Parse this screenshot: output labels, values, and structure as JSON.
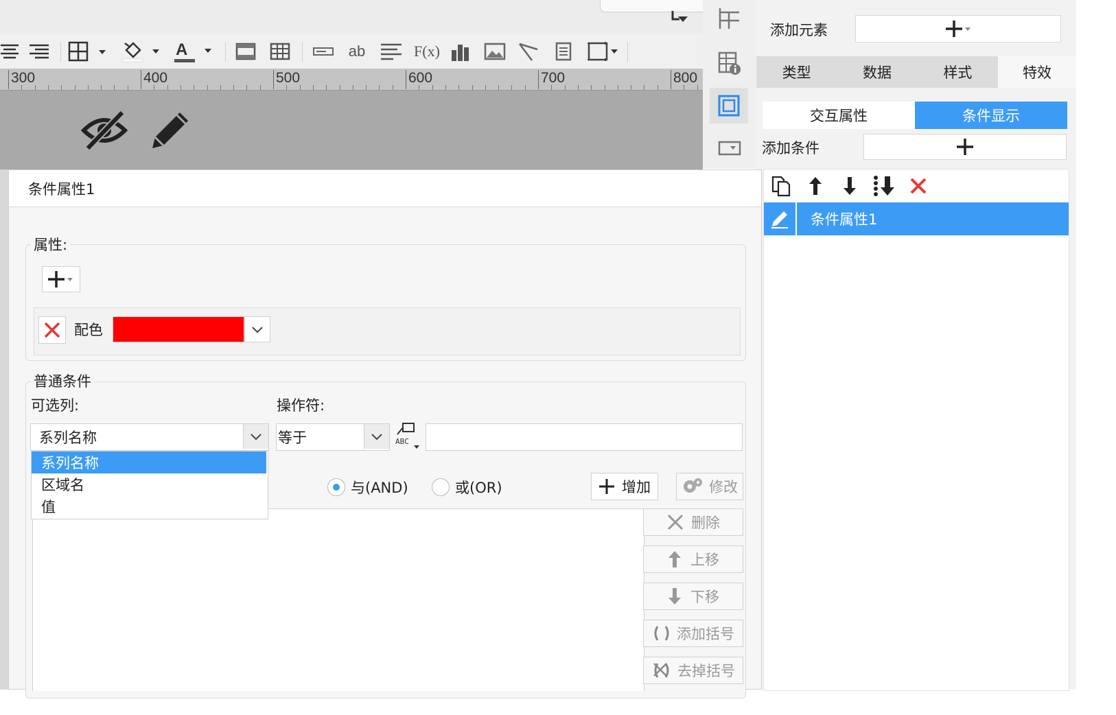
{
  "ruler": {
    "labels": [
      "300",
      "400",
      "500",
      "600",
      "700",
      "800"
    ]
  },
  "right_panel": {
    "add_element_label": "添加元素",
    "tabs": [
      "类型",
      "数据",
      "样式",
      "特效"
    ],
    "subtabs": [
      "交互属性",
      "条件显示"
    ],
    "add_condition_label": "添加条件",
    "condition_item": "条件属性1"
  },
  "dialog": {
    "title": "条件属性1",
    "property_group_title": "属性:",
    "property_row": {
      "label": "配色",
      "color": "#ff0000"
    },
    "normal_group_title": "普通条件",
    "optional_column_label": "可选列:",
    "operator_label": "操作符:",
    "column_value": "系列名称",
    "operator_value": "等于",
    "value_input": "",
    "dropdown_options": [
      "系列名称",
      "区域名",
      "值"
    ],
    "dropdown_selected": 0,
    "radio_and": "与(AND)",
    "radio_or": "或(OR)",
    "radio_selected": "and",
    "buttons": {
      "add": "增加",
      "modify": "修改",
      "delete": "删除",
      "move_up": "上移",
      "move_down": "下移",
      "add_bracket": "添加括号",
      "remove_bracket": "去掉括号"
    }
  },
  "colors": {
    "accent": "#3c9cf5",
    "delete_red": "#e53935",
    "canvas_gray": "#a9a9a9"
  }
}
